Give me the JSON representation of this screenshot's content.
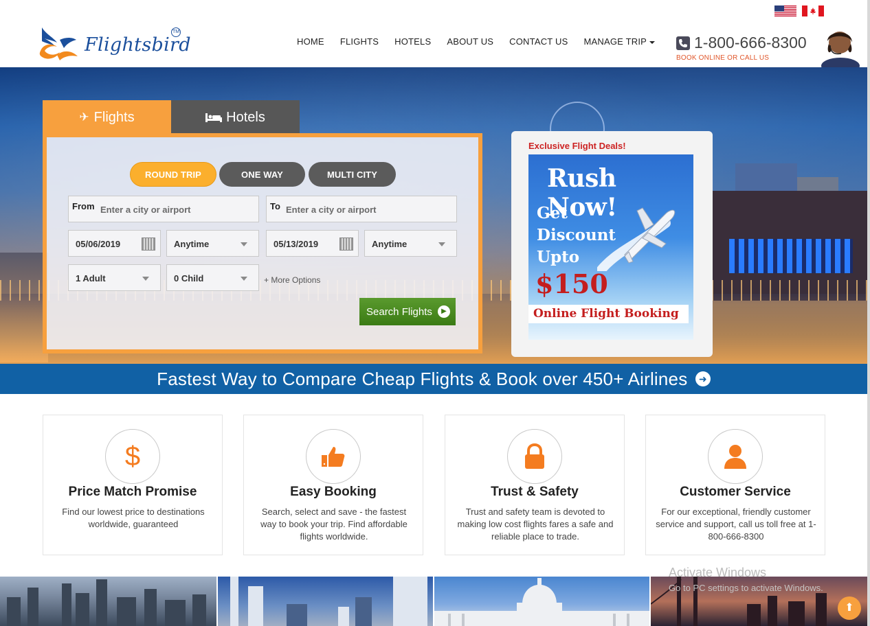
{
  "header": {
    "logo_text": "Flightsbird",
    "logo_tm": "TM",
    "nav": [
      "HOME",
      "FLIGHTS",
      "HOTELS",
      "ABOUT US",
      "CONTACT US",
      "MANAGE TRIP"
    ],
    "phone": "1-800-666-8300",
    "book_online": "BOOK ONLINE OR CALL US"
  },
  "search": {
    "tabs": {
      "flights": "Flights",
      "hotels": "Hotels"
    },
    "trip_types": [
      "ROUND TRIP",
      "ONE WAY",
      "MULTI CITY"
    ],
    "from_label": "From",
    "from_placeholder": "Enter a city or airport",
    "to_label": "To",
    "to_placeholder": "Enter a city or airport",
    "depart_date": "05/06/2019",
    "depart_time": "Anytime",
    "return_date": "05/13/2019",
    "return_time": "Anytime",
    "adults": "1 Adult",
    "children": "0 Child",
    "more_options": "+ More Options",
    "search_button": "Search Flights"
  },
  "deals": {
    "title": "Exclusive Flight Deals!",
    "headline": "Rush Now!",
    "offer_lines": [
      "Get",
      "Discount",
      "Upto"
    ],
    "amount": "$150",
    "tagline": "Online Flight Booking"
  },
  "banner": {
    "text": "Fastest Way to Compare Cheap Flights & Book over 450+ Airlines"
  },
  "features": [
    {
      "icon": "dollar-icon",
      "title": "Price Match Promise",
      "desc": "Find our lowest price to destinations worldwide, guaranteed"
    },
    {
      "icon": "thumbs-up-icon",
      "title": "Easy Booking",
      "desc": "Search, select and save - the fastest way to book your trip. Find affordable flights worldwide."
    },
    {
      "icon": "lock-icon",
      "title": "Trust & Safety",
      "desc": "Trust and safety team is devoted to making low cost flights fares a safe and reliable place to trade."
    },
    {
      "icon": "user-icon",
      "title": "Customer Service",
      "desc": "For our exceptional, friendly customer service and support, call us toll free at 1-800-666-8300"
    }
  ],
  "watermark": {
    "line1": "Activate Windows",
    "line2": "Go to PC settings to activate Windows."
  },
  "colors": {
    "accent": "#f7a03e",
    "banner_blue": "#1161a5",
    "search_green": "#3b7b14",
    "feature_orange": "#f47c20"
  }
}
